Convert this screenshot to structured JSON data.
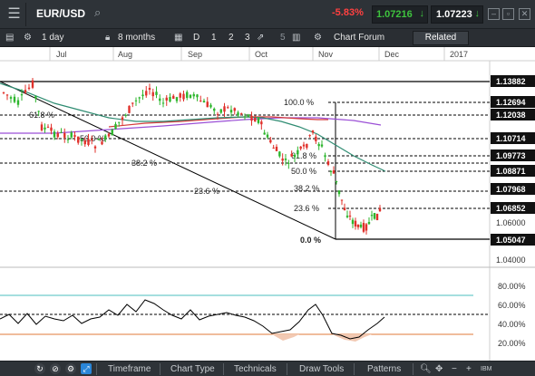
{
  "topbar": {
    "menu_icon": "hamburger-menu-icon",
    "symbol": "EUR/USD",
    "search_icon": "search-icon",
    "change": "-5.83%",
    "sell_price": "1.07216",
    "sell_arrow": "↓",
    "buy_price": "1.07223",
    "buy_arrow": "↓",
    "window_buttons": [
      "minimize-icon",
      "restore-icon",
      "close-icon"
    ]
  },
  "toolbar": {
    "interval": "1 day",
    "range": "8 months",
    "draw_modes": [
      "D",
      "1",
      "2",
      "3"
    ],
    "counter": "5",
    "forum": "Chart Forum",
    "related": "Related"
  },
  "chart": {
    "x_labels": [
      "Jul",
      "Aug",
      "Sep",
      "Oct",
      "Nov",
      "Dec",
      "2017"
    ],
    "price_labels": [
      "1.13882",
      "1.12694",
      "1.12038",
      "1.10714",
      "1.09773",
      "1.08871",
      "1.07968",
      "1.06852",
      "1.06000",
      "1.05047",
      "1.04000"
    ],
    "highlighted_prices": [
      "1.13882",
      "1.12694",
      "1.12038",
      "1.10714",
      "1.09773",
      "1.08871",
      "1.07968",
      "1.06852",
      "1.05047"
    ],
    "fib_left": [
      "61.8 %",
      "50.0 %",
      "38.2 %",
      "23.6 %"
    ],
    "fib_right": [
      "100.0 %",
      "61.8 %",
      "50.0 %",
      "38.2 %",
      "23.6 %",
      "0.0 %"
    ],
    "osc_labels": [
      "80.00%",
      "60.00%",
      "40.00%",
      "20.00%"
    ],
    "colors": {
      "up_candle": "#2db62d",
      "down_candle": "#e0302a",
      "ma_fast": "#2f8c72",
      "ma_mid": "#d43a3a",
      "ma_slow": "#9b4fd6",
      "osc_upper": "#4bbfbf",
      "osc_lower": "#e07a3a"
    }
  },
  "bottombar": {
    "icons": [
      "refresh-icon",
      "no-entry-icon",
      "settings-icon",
      "fullscreen-icon"
    ],
    "tabs": [
      "Timeframe",
      "Chart Type",
      "Technicals",
      "Draw Tools",
      "Patterns"
    ],
    "zoom_icons": [
      "zoom-in-icon",
      "pan-icon",
      "zoom-minus-icon",
      "zoom-plus-icon",
      "logo-icon"
    ]
  }
}
